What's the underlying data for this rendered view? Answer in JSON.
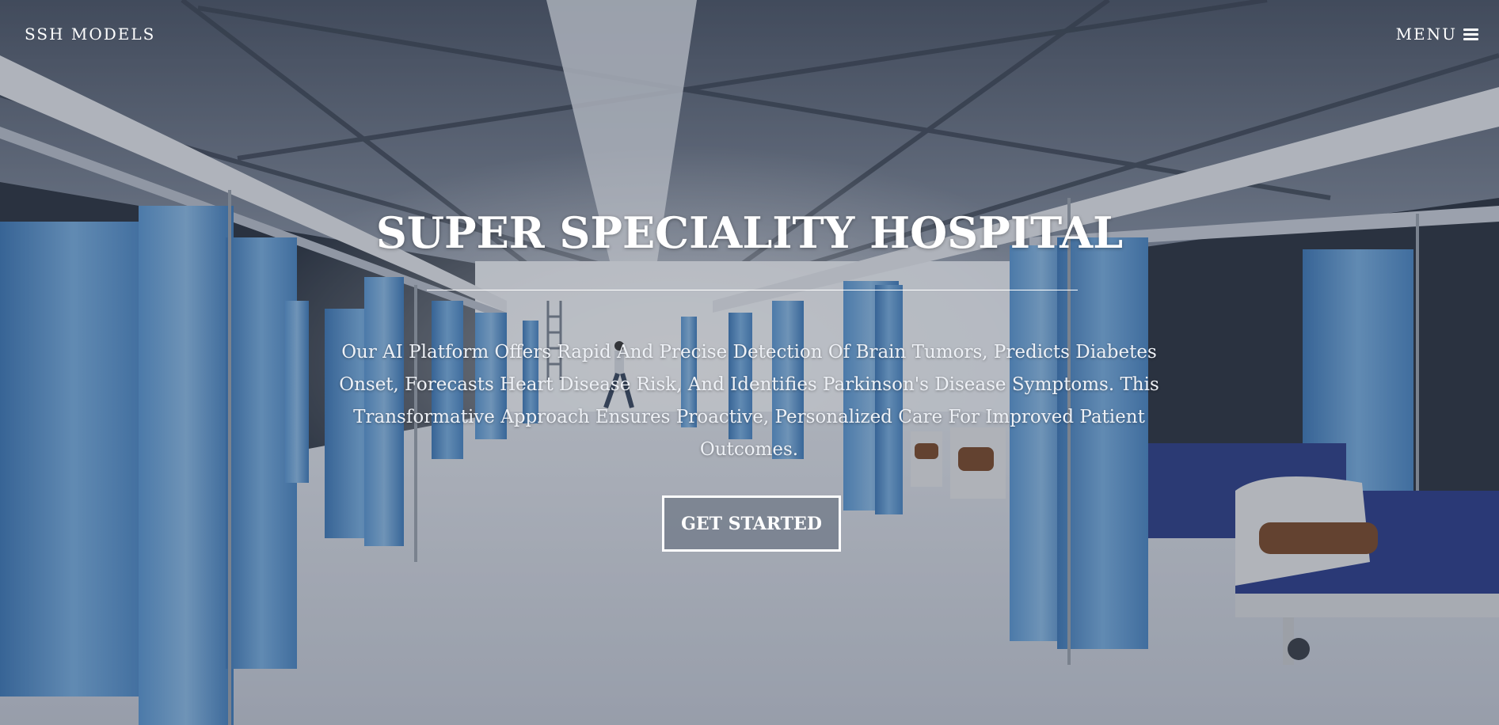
{
  "nav": {
    "brand": "SSH MODELS",
    "menu_label": "MENU",
    "menu_icon": "hamburger-menu-icon"
  },
  "hero": {
    "title": "SUPER SPECIALITY HOSPITAL",
    "description": "Our AI Platform Offers Rapid And Precise Detection Of Brain Tumors, Predicts Diabetes Onset, Forecasts Heart Disease Risk, And Identifies Parkinson's Disease Symptoms. This Transformative Approach Ensures Proactive, Personalized Care For Improved Patient Outcomes.",
    "cta_label": "GET STARTED",
    "background_image": "hospital-ward-with-blue-curtains-and-beds"
  },
  "colors": {
    "text": "#ffffff",
    "curtain": "#5f97cf",
    "floor": "#cfd4de",
    "ceiling": "#4a5566"
  }
}
